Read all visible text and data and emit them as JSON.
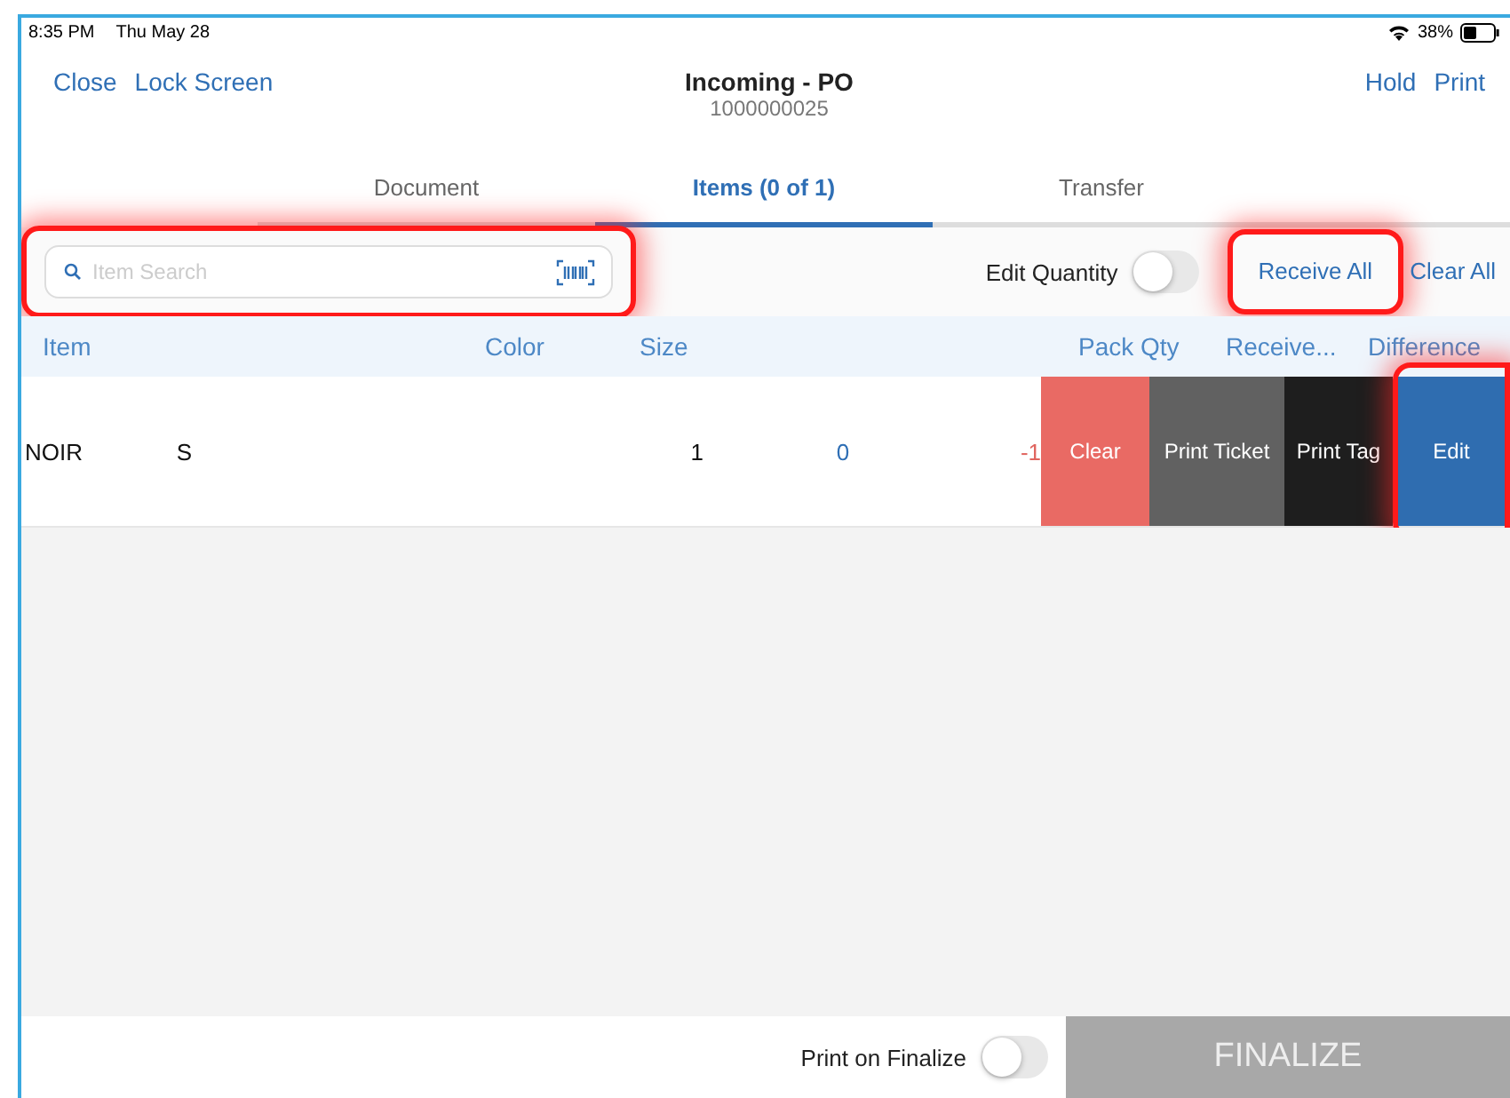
{
  "status_bar": {
    "time": "8:35 PM",
    "date": "Thu May 28",
    "battery": "38%"
  },
  "header": {
    "left_buttons": [
      "Close",
      "Lock Screen"
    ],
    "title": "Incoming - PO",
    "subtitle": "1000000025",
    "right_buttons": [
      "Hold",
      "Print"
    ]
  },
  "tabs": [
    {
      "label": "Document",
      "selected": false
    },
    {
      "label": "Items (0 of 1)",
      "selected": true
    },
    {
      "label": "Transfer",
      "selected": false
    }
  ],
  "toolbar": {
    "search": {
      "placeholder": "Item Search",
      "highlighted": true
    },
    "edit_quantity": {
      "label": "Edit Quantity",
      "on": false
    },
    "actions": [
      {
        "label": "Receive All",
        "highlighted": true
      },
      {
        "label": "Clear All",
        "highlighted": false
      }
    ]
  },
  "table": {
    "columns": [
      "Item",
      "Color",
      "Size",
      "Pack Qty",
      "Receive...",
      "Difference"
    ],
    "rows": [
      {
        "cells": [
          {
            "text": "NOIR",
            "color": "#111111"
          },
          {
            "text": "S",
            "color": "#111111"
          },
          {
            "text": "1",
            "color": "#111111"
          },
          {
            "text": "0",
            "color": "#2f6fb5"
          },
          {
            "text": "-1",
            "color": "#e0655f"
          }
        ],
        "actions": [
          {
            "label": "Clear",
            "color": "#e96a64",
            "highlighted": false
          },
          {
            "label": "Print Ticket",
            "color": "#616161",
            "highlighted": false
          },
          {
            "label": "Print Tag",
            "color": "#1e1e1e",
            "highlighted": false
          },
          {
            "label": "Edit",
            "color": "#2f6db0",
            "highlighted": true
          }
        ]
      }
    ]
  },
  "footer": {
    "print_on_finalize": {
      "label": "Print on Finalize",
      "on": false
    },
    "finalize": {
      "label": "FINALIZE",
      "disabled": true
    }
  }
}
